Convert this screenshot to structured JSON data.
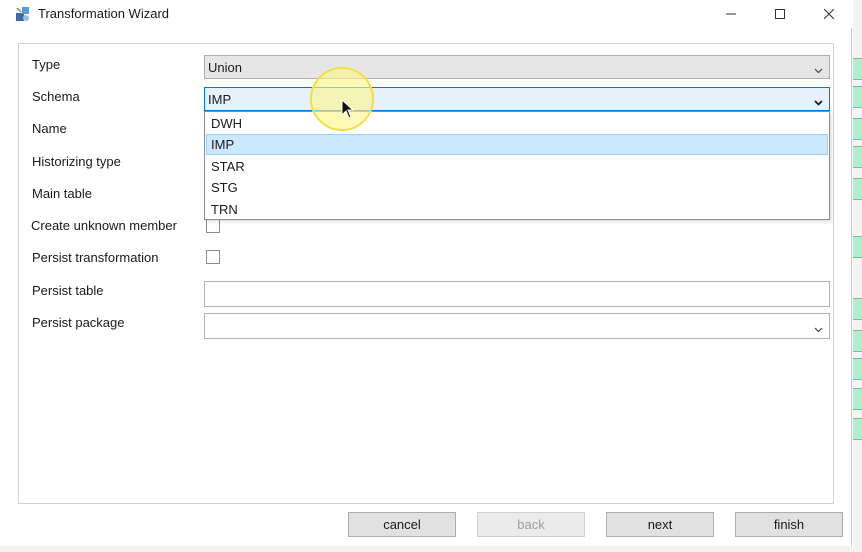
{
  "window": {
    "title": "Transformation Wizard",
    "icons": {
      "app": "app-wizard-icon",
      "minimize": "minimize-icon",
      "maximize": "maximize-icon",
      "close": "close-icon"
    }
  },
  "form": {
    "type": {
      "label": "Type",
      "value": "Union"
    },
    "schema": {
      "label": "Schema",
      "value": "IMP"
    },
    "name": {
      "label": "Name",
      "value": ""
    },
    "historizing_type": {
      "label": "Historizing type"
    },
    "main_table": {
      "label": "Main table"
    },
    "create_unknown_member": {
      "label": "Create unknown member",
      "checked": false
    },
    "persist_transformation": {
      "label": "Persist transformation",
      "checked": false
    },
    "persist_table": {
      "label": "Persist table",
      "value": ""
    },
    "persist_package": {
      "label": "Persist package",
      "value": ""
    }
  },
  "schema_dropdown": {
    "options": [
      "DWH",
      "IMP",
      "STAR",
      "STG",
      "TRN"
    ],
    "selected": "IMP"
  },
  "buttons": {
    "cancel": "cancel",
    "back": "back",
    "next": "next",
    "finish": "finish"
  },
  "colors": {
    "selection": "#cce8ff",
    "focus_border": "#0078d7",
    "cursor_highlight": "#fff58c"
  }
}
